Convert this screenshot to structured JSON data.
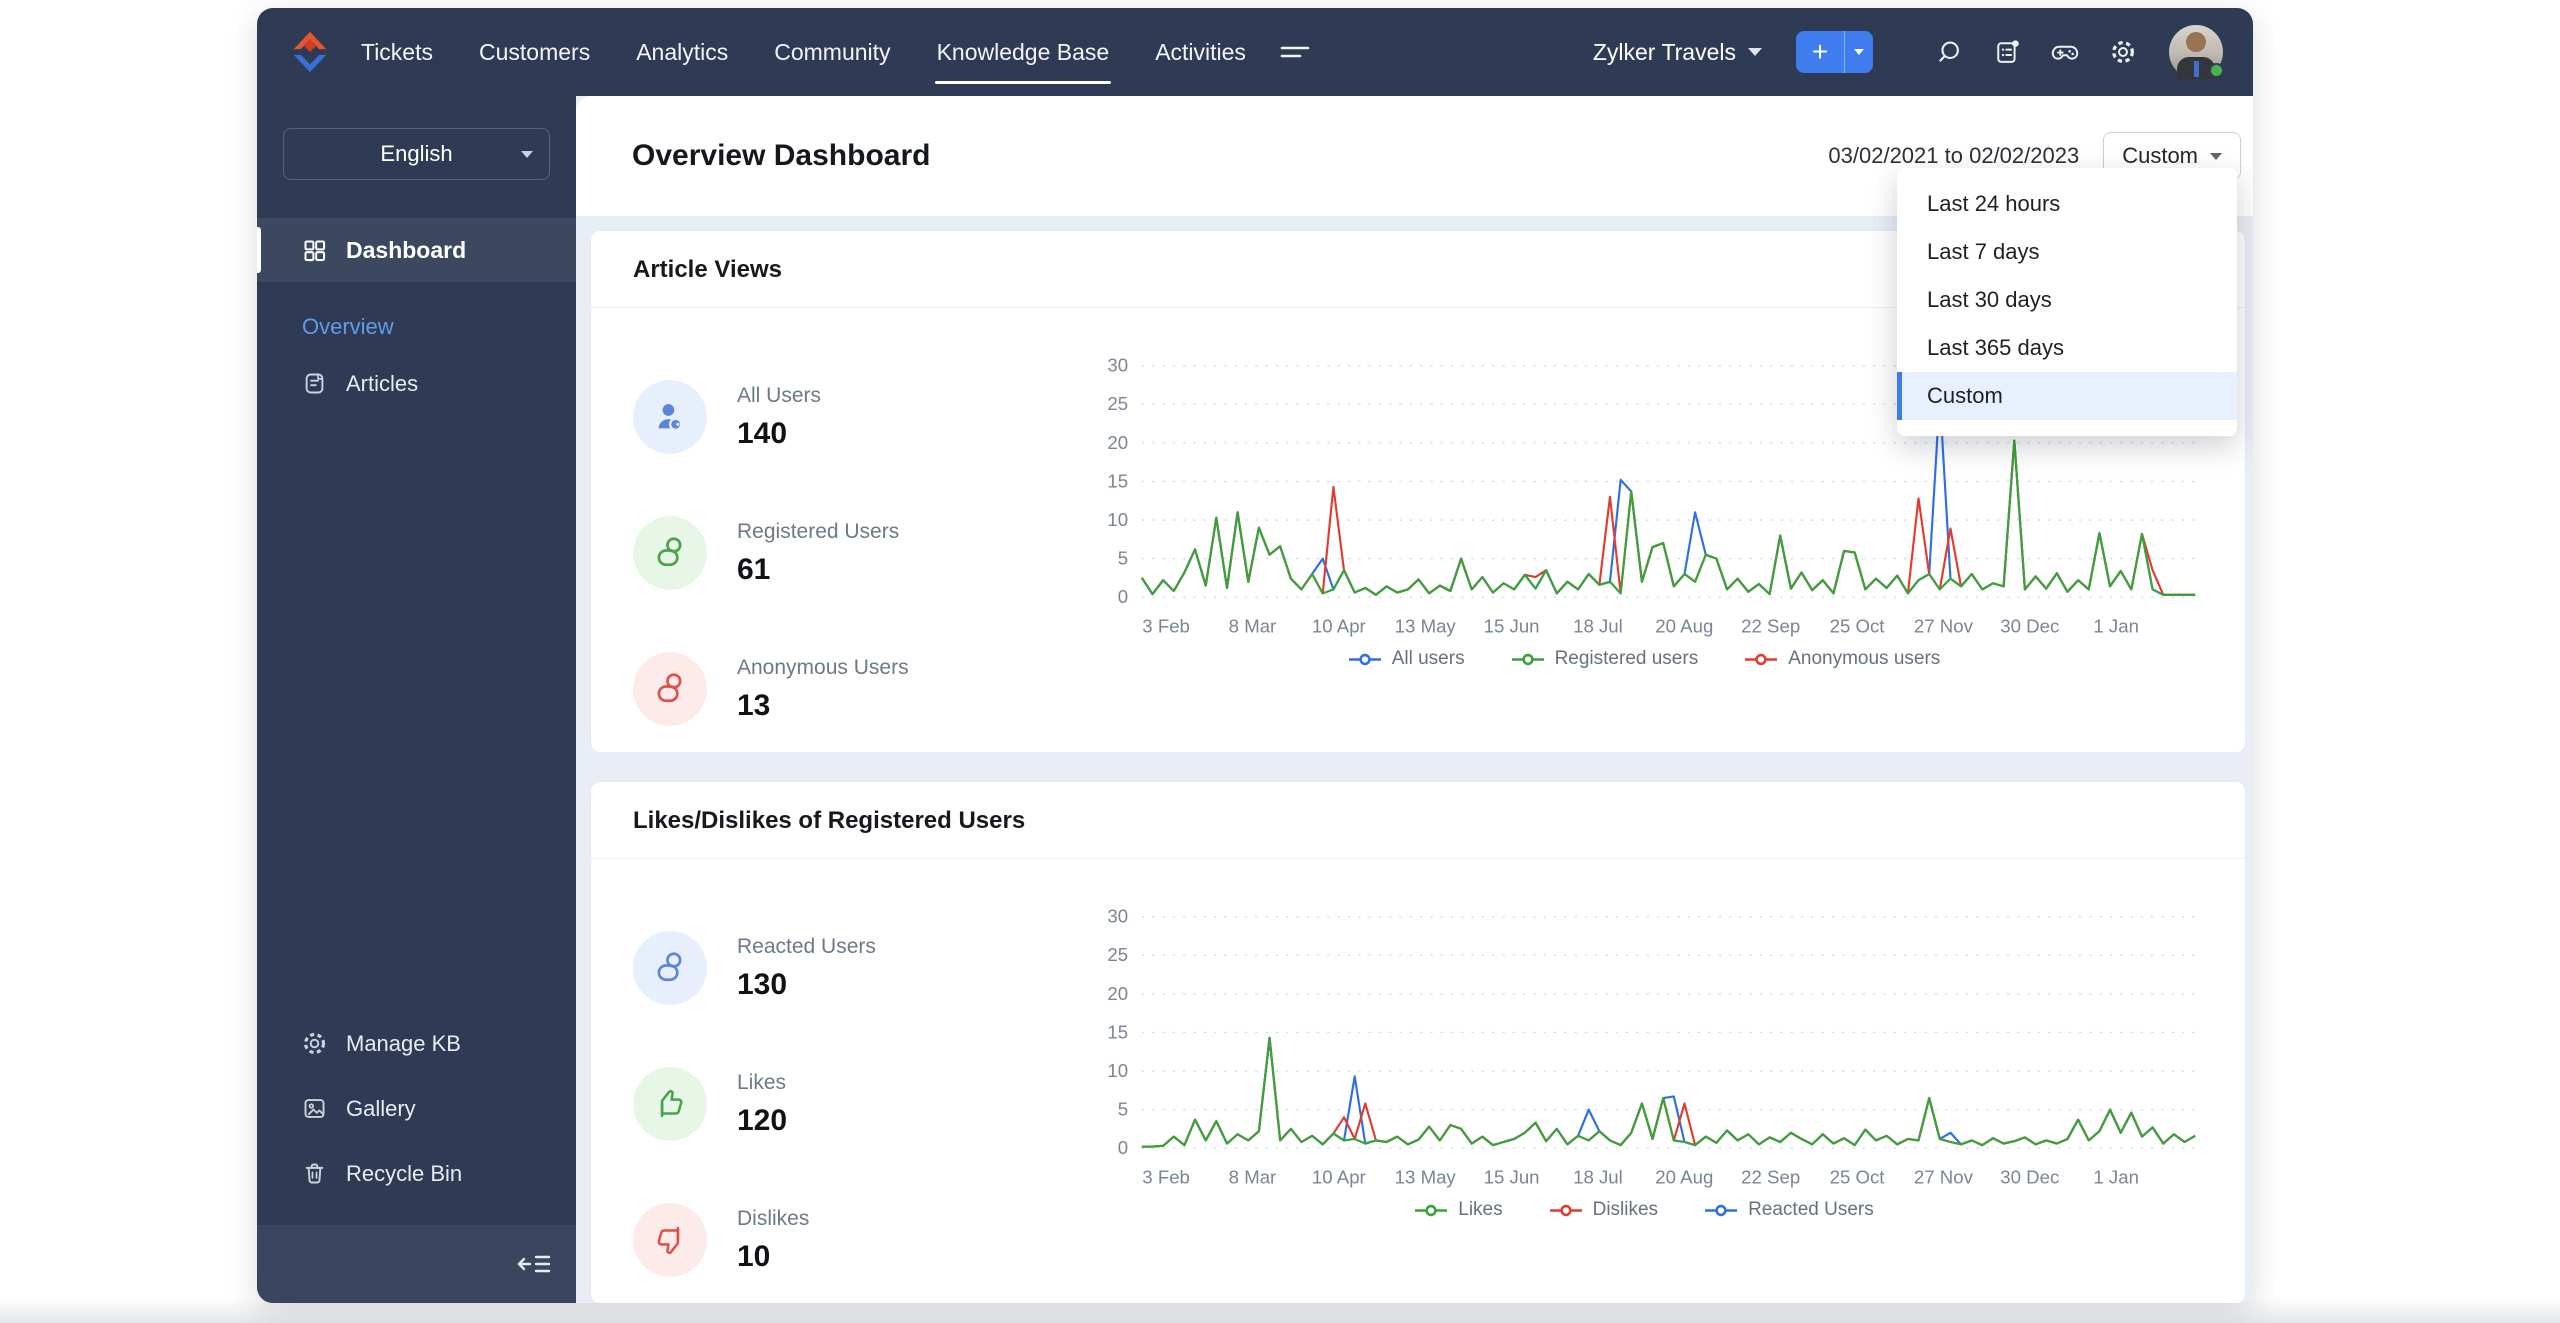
{
  "topnav": {
    "items": [
      {
        "label": "Tickets"
      },
      {
        "label": "Customers"
      },
      {
        "label": "Analytics"
      },
      {
        "label": "Community"
      },
      {
        "label": "Knowledge Base"
      },
      {
        "label": "Activities"
      }
    ],
    "active_item": "Knowledge Base",
    "portal_label": "Zylker Travels",
    "plus_label": "+"
  },
  "sidebar": {
    "language": "English",
    "dashboard": {
      "label": "Dashboard"
    },
    "overview": {
      "label": "Overview"
    },
    "articles": {
      "label": "Articles"
    },
    "manage_kb": {
      "label": "Manage KB"
    },
    "gallery": {
      "label": "Gallery"
    },
    "recycle_bin": {
      "label": "Recycle Bin"
    }
  },
  "header": {
    "title": "Overview Dashboard",
    "date_range": "03/02/2021 to 02/02/2023",
    "range_button": "Custom"
  },
  "range_menu": {
    "items": [
      {
        "label": "Last 24 hours"
      },
      {
        "label": "Last 7 days"
      },
      {
        "label": "Last 30 days"
      },
      {
        "label": "Last 365 days"
      },
      {
        "label": "Custom"
      }
    ],
    "selected": "Custom"
  },
  "cards": [
    {
      "title": "Article Views",
      "stats": [
        {
          "label": "All Users",
          "value": "140"
        },
        {
          "label": "Registered Users",
          "value": "61"
        },
        {
          "label": "Anonymous Users",
          "value": "13"
        }
      ]
    },
    {
      "title": "Likes/Dislikes of Registered Users",
      "stats": [
        {
          "label": "Reacted Users",
          "value": "130"
        },
        {
          "label": "Likes",
          "value": "120"
        },
        {
          "label": "Dislikes",
          "value": "10"
        }
      ]
    }
  ],
  "colors": {
    "navy": "#2f3b55",
    "accent_blue": "#3f7cee",
    "line_blue": "#2f6fe4",
    "line_green": "#3aa23a",
    "line_red": "#e23c2e",
    "grid": "#d7dce6",
    "axis_text": "#7b8494",
    "selected_bg": "#e9f0fd"
  },
  "chart_data": [
    {
      "type": "line",
      "title": "Article Views",
      "x_tick_labels": [
        "3 Feb",
        "8 Mar",
        "10 Apr",
        "13 May",
        "15 Jun",
        "18 Jul",
        "20 Aug",
        "22 Sep",
        "25 Oct",
        "27 Nov",
        "30 Dec",
        "1 Jan"
      ],
      "ylim": [
        0,
        30
      ],
      "y_ticks": [
        0,
        5,
        10,
        15,
        20,
        25,
        30
      ],
      "grid": "horizontal-dashed",
      "legend_position": "bottom",
      "draw_order": [
        0,
        2,
        1
      ],
      "series": [
        {
          "name": "All users",
          "color": "#2f6fe4",
          "values": [
            2.5,
            0.4,
            2.2,
            0.8,
            3.2,
            6.2,
            1.5,
            10.3,
            1.2,
            11,
            2,
            9,
            5.5,
            6.6,
            2.4,
            1,
            3,
            5,
            1,
            3.5,
            0.6,
            1.2,
            0.3,
            1.4,
            0.6,
            1,
            2.3,
            0.5,
            1.5,
            0.8,
            5,
            1,
            2.6,
            0.6,
            1.8,
            1,
            2.9,
            1.1,
            3.5,
            0.5,
            2,
            1,
            3,
            1.6,
            2,
            15.2,
            13.7,
            2,
            6.5,
            7,
            1.4,
            3,
            11,
            5.5,
            5,
            1,
            2.4,
            0.7,
            1.7,
            0.4,
            8,
            1.1,
            3.2,
            0.9,
            2.2,
            0.5,
            6,
            5.8,
            1,
            2.4,
            1.2,
            2.8,
            0.5,
            2.2,
            3,
            26,
            2.4,
            1.4,
            3,
            1,
            1.8,
            1.4,
            20.3,
            1,
            2.7,
            1.1,
            3.1,
            0.7,
            2.2,
            1,
            8.3,
            1.4,
            3.4,
            1,
            8.2,
            1,
            0.3,
            0.3,
            0.3,
            0.3
          ]
        },
        {
          "name": "Registered users",
          "color": "#3aa23a",
          "values": [
            2.5,
            0.4,
            2.2,
            0.8,
            3.2,
            6.2,
            1.5,
            10.3,
            1.2,
            11,
            2,
            9,
            5.5,
            6.6,
            2.4,
            1,
            3,
            0.5,
            1,
            3.5,
            0.6,
            1.2,
            0.3,
            1.4,
            0.6,
            1,
            2.3,
            0.5,
            1.5,
            0.8,
            5,
            1,
            2.6,
            0.6,
            1.8,
            1,
            2.9,
            1.1,
            3.5,
            0.5,
            2,
            1,
            3,
            1.6,
            2,
            0.5,
            13.7,
            2,
            6.5,
            7,
            1.4,
            3,
            2,
            5.5,
            5,
            1,
            2.4,
            0.7,
            1.7,
            0.4,
            8,
            1.1,
            3.2,
            0.9,
            2.2,
            0.5,
            6,
            5.8,
            1,
            2.4,
            1.2,
            2.8,
            0.5,
            2.2,
            3,
            1,
            2.4,
            1.4,
            3,
            1,
            1.8,
            1.4,
            20.3,
            1,
            2.7,
            1.1,
            3.1,
            0.7,
            2.2,
            1,
            8.3,
            1.4,
            3.4,
            1,
            8.2,
            1,
            0.3,
            0.3,
            0.3,
            0.3
          ]
        },
        {
          "name": "Anonymous users",
          "color": "#e23c2e",
          "values": [
            2.5,
            0.4,
            2.2,
            0.8,
            3.2,
            6.2,
            1.5,
            10.3,
            1.2,
            11,
            2,
            9,
            5.5,
            6.6,
            2.4,
            1,
            3,
            0.5,
            14.3,
            3.5,
            0.6,
            1.2,
            0.3,
            1.4,
            0.6,
            1,
            2.3,
            0.5,
            1.5,
            0.8,
            5,
            1,
            2.6,
            0.6,
            1.8,
            1,
            2.9,
            2.6,
            3.5,
            0.5,
            2,
            1,
            3,
            1.6,
            13,
            0.5,
            13.7,
            2,
            6.5,
            7,
            1.4,
            3,
            2,
            5.5,
            5,
            1,
            2.4,
            0.7,
            1.7,
            0.4,
            8,
            1.1,
            3.2,
            0.9,
            2.2,
            0.5,
            6,
            5.8,
            1,
            2.4,
            1.2,
            2.8,
            0.5,
            12.8,
            3,
            1,
            8.9,
            1.4,
            3,
            1,
            1.8,
            1.4,
            20.3,
            1,
            2.7,
            1.1,
            3.1,
            0.7,
            2.2,
            1,
            8.3,
            1.4,
            3.4,
            1,
            8.2,
            3.5,
            0.3,
            0.3,
            0.3,
            0.3
          ]
        }
      ]
    },
    {
      "type": "line",
      "title": "Likes/Dislikes of Registered Users",
      "x_tick_labels": [
        "3 Feb",
        "8 Mar",
        "10 Apr",
        "13 May",
        "15 Jun",
        "18 Jul",
        "20 Aug",
        "22 Sep",
        "25 Oct",
        "27 Nov",
        "30 Dec",
        "1 Jan"
      ],
      "ylim": [
        0,
        30
      ],
      "y_ticks": [
        0,
        5,
        10,
        15,
        20,
        25,
        30
      ],
      "grid": "horizontal-dashed",
      "legend_position": "bottom",
      "draw_order": [
        2,
        1,
        0
      ],
      "series": [
        {
          "name": "Likes",
          "color": "#3aa23a",
          "values": [
            0.2,
            0.2,
            0.3,
            1.5,
            0.4,
            3.7,
            1,
            3.5,
            0.6,
            1.8,
            1,
            2.2,
            14.3,
            1,
            2.5,
            0.8,
            1.6,
            0.5,
            1.9,
            1,
            1.2,
            0.6,
            1,
            0.8,
            1.5,
            0.5,
            1.1,
            2.8,
            1,
            3,
            2.5,
            0.6,
            1.5,
            0.4,
            0.8,
            1.2,
            2,
            3.3,
            0.9,
            2.5,
            0.5,
            1.6,
            1,
            2.2,
            1,
            0.4,
            2,
            5.8,
            1.2,
            6.5,
            1,
            0.8,
            0.4,
            1.5,
            0.7,
            2.3,
            1,
            1.8,
            0.5,
            1.4,
            0.8,
            2,
            1.2,
            0.5,
            1.8,
            0.6,
            1.3,
            0.4,
            2.4,
            1,
            1.6,
            0.5,
            1.2,
            1,
            6.5,
            1.2,
            0.8,
            0.5,
            1,
            0.4,
            1.3,
            0.6,
            0.9,
            1.4,
            0.5,
            1,
            0.6,
            1.2,
            3.7,
            1,
            2.2,
            5,
            2,
            4.6,
            1.5,
            2.7,
            0.6,
            1.8,
            0.8,
            1.6
          ]
        },
        {
          "name": "Dislikes",
          "color": "#e23c2e",
          "values": [
            0.2,
            0.2,
            0.3,
            1.5,
            0.4,
            3.7,
            1,
            3.5,
            0.6,
            1.8,
            1,
            2.2,
            14.3,
            1,
            2.5,
            0.8,
            1.6,
            0.5,
            1.9,
            4,
            1.2,
            5.8,
            1,
            0.8,
            1.5,
            0.5,
            1.1,
            2.8,
            1,
            3,
            2.5,
            0.6,
            1.5,
            0.4,
            0.8,
            1.2,
            2,
            3.3,
            0.9,
            2.5,
            0.5,
            1.6,
            1,
            2.2,
            1,
            0.4,
            2,
            5.8,
            1.2,
            6.5,
            1,
            5.8,
            0.4,
            1.5,
            0.7,
            2.3,
            1,
            1.8,
            0.5,
            1.4,
            0.8,
            2,
            1.2,
            0.5,
            1.8,
            0.6,
            1.3,
            0.4,
            2.4,
            1,
            1.6,
            0.5,
            1.2,
            1,
            6.5,
            1.2,
            0.8,
            0.5,
            1,
            0.4,
            1.3,
            0.6,
            0.9,
            1.4,
            0.5,
            1,
            0.6,
            1.2,
            3.7,
            1,
            2.2,
            5,
            2,
            4.6,
            1.5,
            2.7,
            0.6,
            1.8,
            0.8,
            1.6
          ]
        },
        {
          "name": "Reacted Users",
          "color": "#2f6fe4",
          "values": [
            0.2,
            0.2,
            0.3,
            1.5,
            0.4,
            3.7,
            1,
            3.5,
            0.6,
            1.8,
            1,
            2.2,
            14.3,
            1,
            2.5,
            0.8,
            1.6,
            0.5,
            1.9,
            1,
            9.3,
            0.6,
            1,
            0.8,
            1.5,
            0.5,
            1.1,
            2.8,
            1,
            3,
            2.5,
            0.6,
            1.5,
            0.4,
            0.8,
            1.2,
            2,
            3.3,
            0.9,
            2.5,
            0.5,
            1.6,
            5,
            2.2,
            1,
            0.4,
            2,
            5.8,
            1.2,
            6.5,
            6.7,
            0.8,
            0.4,
            1.5,
            0.7,
            2.3,
            1,
            1.8,
            0.5,
            1.4,
            0.8,
            2,
            1.2,
            0.5,
            1.8,
            0.6,
            1.3,
            0.4,
            2.4,
            1,
            1.6,
            0.5,
            1.2,
            1,
            6.5,
            1.2,
            2,
            0.5,
            1,
            0.4,
            1.3,
            0.6,
            0.9,
            1.4,
            0.5,
            1,
            0.6,
            1.2,
            3.7,
            1,
            2.2,
            5,
            2,
            4.6,
            1.5,
            2.7,
            0.6,
            1.8,
            0.8,
            1.6
          ]
        }
      ]
    }
  ]
}
